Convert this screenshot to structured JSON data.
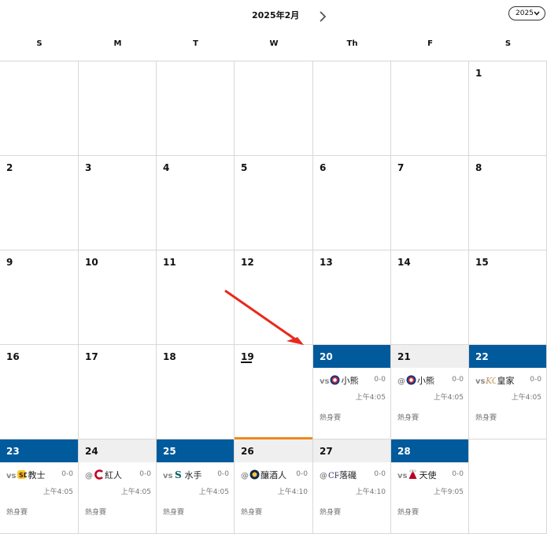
{
  "header": {
    "month_title": "2025年2月",
    "year_select": "2025"
  },
  "weekdays": [
    "S",
    "M",
    "T",
    "W",
    "Th",
    "F",
    "S"
  ],
  "rows": [
    [
      {
        "day": ""
      },
      {
        "day": ""
      },
      {
        "day": ""
      },
      {
        "day": ""
      },
      {
        "day": ""
      },
      {
        "day": ""
      },
      {
        "day": "1"
      }
    ],
    [
      {
        "day": "2"
      },
      {
        "day": "3"
      },
      {
        "day": "4"
      },
      {
        "day": "5"
      },
      {
        "day": "6"
      },
      {
        "day": "7"
      },
      {
        "day": "8"
      }
    ],
    [
      {
        "day": "9"
      },
      {
        "day": "10"
      },
      {
        "day": "11"
      },
      {
        "day": "12"
      },
      {
        "day": "13"
      },
      {
        "day": "14"
      },
      {
        "day": "15"
      }
    ],
    [
      {
        "day": "16"
      },
      {
        "day": "17"
      },
      {
        "day": "18"
      },
      {
        "day": "19",
        "today": true
      },
      {
        "day": "20",
        "kind": "home",
        "prefix": "vs",
        "team": "小熊",
        "logo": "cubs-logo-icon",
        "record": "0-0",
        "time": "上午4:05",
        "type": "熱身賽"
      },
      {
        "day": "21",
        "kind": "away",
        "prefix": "@",
        "team": "小熊",
        "logo": "cubs-logo-icon",
        "record": "0-0",
        "time": "上午4:05",
        "type": "熱身賽"
      },
      {
        "day": "22",
        "kind": "home",
        "prefix": "vs",
        "team": "皇家",
        "logo": "royals-logo-icon",
        "record": "0-0",
        "time": "上午4:05",
        "type": "熱身賽"
      }
    ],
    [
      {
        "day": "23",
        "kind": "home",
        "prefix": "vs",
        "team": "教士",
        "logo": "padres-logo-icon",
        "record": "0-0",
        "time": "上午4:05",
        "type": "熱身賽"
      },
      {
        "day": "24",
        "kind": "away",
        "prefix": "@",
        "team": "紅人",
        "logo": "reds-logo-icon",
        "record": "0-0",
        "time": "上午4:05",
        "type": "熱身賽"
      },
      {
        "day": "25",
        "kind": "home",
        "prefix": "vs",
        "team": "水手",
        "logo": "mariners-logo-icon",
        "record": "0-0",
        "time": "上午4:05",
        "type": "熱身賽"
      },
      {
        "day": "26",
        "kind": "away",
        "prefix": "@",
        "team": "釀酒人",
        "logo": "brewers-logo-icon",
        "record": "0-0",
        "time": "上午4:10",
        "type": "熱身賽"
      },
      {
        "day": "27",
        "kind": "away",
        "prefix": "@",
        "team": "落磯",
        "logo": "rockies-logo-icon",
        "record": "0-0",
        "time": "上午4:10",
        "type": "熱身賽"
      },
      {
        "day": "28",
        "kind": "home",
        "prefix": "vs",
        "team": "天使",
        "logo": "angels-logo-icon",
        "record": "0-0",
        "time": "上午9:05",
        "type": "熱身賽"
      },
      {
        "day": ""
      }
    ]
  ],
  "colors": {
    "home": "#005a9c",
    "away": "#efefef",
    "today": "#ef8a1d",
    "annotation": "#e8291c"
  }
}
